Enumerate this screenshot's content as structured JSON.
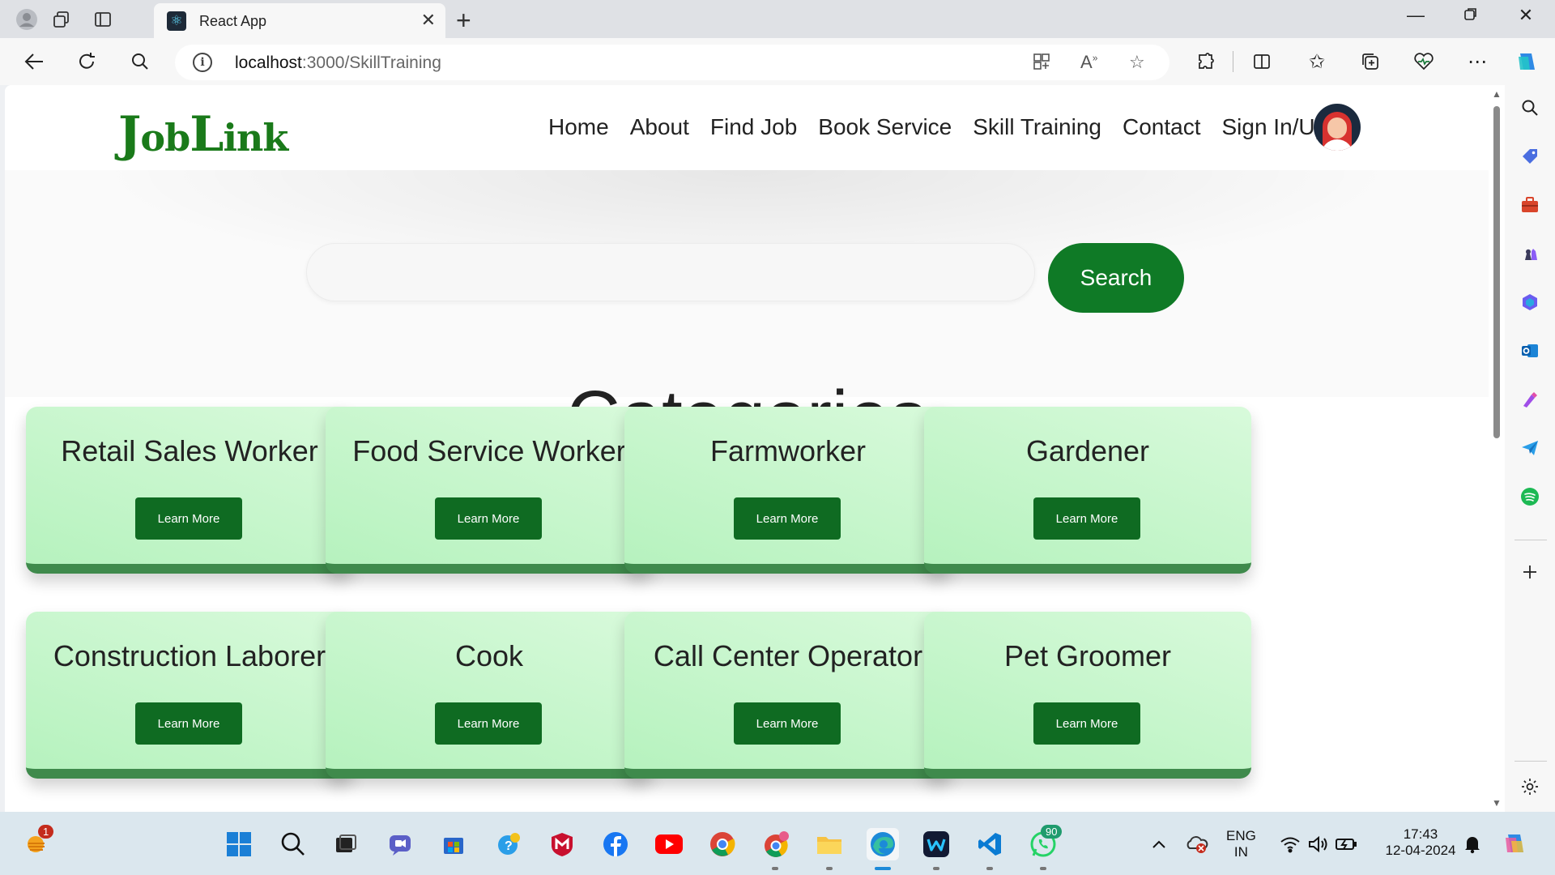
{
  "browser": {
    "tab_title": "React App",
    "url_host": "localhost",
    "url_path": ":3000/SkillTraining"
  },
  "site": {
    "logo_big_j": "J",
    "logo_ob": "ob",
    "logo_big_l": "L",
    "logo_ink": "ink",
    "nav": [
      "Home",
      "About",
      "Find Job",
      "Book Service",
      "Skill Training",
      "Contact",
      "Sign In/Up"
    ],
    "search_placeholder": "",
    "search_button": "Search",
    "section_title": "Categories",
    "cards": [
      {
        "title": "Retail Sales Worker",
        "button": "Learn More"
      },
      {
        "title": "Food Service Worker",
        "button": "Learn More"
      },
      {
        "title": "Farmworker",
        "button": "Learn More"
      },
      {
        "title": "Gardener",
        "button": "Learn More"
      },
      {
        "title": "Construction Laborer",
        "button": "Learn More"
      },
      {
        "title": "Cook",
        "button": "Learn More"
      },
      {
        "title": "Call Center Operator",
        "button": "Learn More"
      },
      {
        "title": "Pet Groomer",
        "button": "Learn More"
      }
    ]
  },
  "taskbar": {
    "weather_badge": "1",
    "whatsapp_badge": "90",
    "language_line1": "ENG",
    "language_line2": "IN",
    "time": "17:43",
    "date": "12-04-2024"
  },
  "colors": {
    "brand_green": "#0f7a26",
    "card_green": "#b6f2be",
    "card_border": "#3f8a4c"
  }
}
